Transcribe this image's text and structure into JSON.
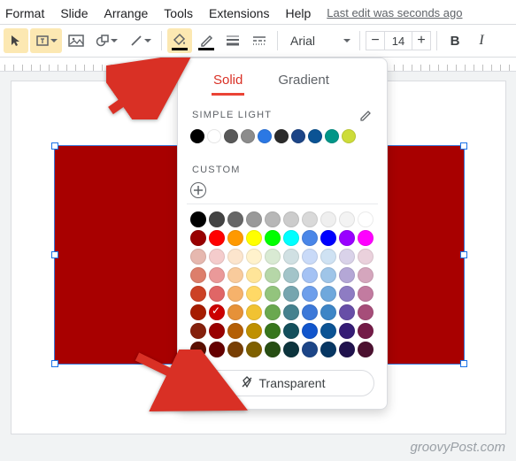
{
  "menubar": {
    "items": [
      "Format",
      "Slide",
      "Arrange",
      "Tools",
      "Extensions",
      "Help"
    ],
    "edit_status": "Last edit was seconds ago"
  },
  "toolbar": {
    "font_family": "Arial",
    "font_size": "14"
  },
  "popover": {
    "tabs": {
      "solid": "Solid",
      "gradient": "Gradient",
      "active": "solid"
    },
    "theme_label": "SIMPLE LIGHT",
    "custom_label": "CUSTOM",
    "transparent_label": "Transparent",
    "theme_colors": [
      "#000000",
      "#ffffff",
      "#595959",
      "#8c8c8c",
      "#2b78e4",
      "#2b2b2b",
      "#1c4587",
      "#0b5394",
      "#009688",
      "#cddc39"
    ],
    "selected_grid_color": "#cc0000",
    "grid_rows": [
      [
        "#000000",
        "#434343",
        "#666666",
        "#999999",
        "#b7b7b7",
        "#cccccc",
        "#d9d9d9",
        "#efefef",
        "#f3f3f3",
        "#ffffff"
      ],
      [
        "#980000",
        "#ff0000",
        "#ff9900",
        "#ffff00",
        "#00ff00",
        "#00ffff",
        "#4a86e8",
        "#0000ff",
        "#9900ff",
        "#ff00ff"
      ],
      [
        "#e6b8af",
        "#f4cccc",
        "#fce5cd",
        "#fff2cc",
        "#d9ead3",
        "#d0e0e3",
        "#c9daf8",
        "#cfe2f3",
        "#d9d2e9",
        "#ead1dc"
      ],
      [
        "#dd7e6b",
        "#ea9999",
        "#f9cb9c",
        "#ffe599",
        "#b6d7a8",
        "#a2c4c9",
        "#a4c2f4",
        "#9fc5e8",
        "#b4a7d6",
        "#d5a6bd"
      ],
      [
        "#cc4125",
        "#e06666",
        "#f6b26b",
        "#ffd966",
        "#93c47d",
        "#76a5af",
        "#6d9eeb",
        "#6fa8dc",
        "#8e7cc3",
        "#c27ba0"
      ],
      [
        "#a61c00",
        "#cc0000",
        "#e69138",
        "#f1c232",
        "#6aa84f",
        "#45818e",
        "#3c78d8",
        "#3d85c6",
        "#674ea7",
        "#a64d79"
      ],
      [
        "#85200c",
        "#990000",
        "#b45f06",
        "#bf9000",
        "#38761d",
        "#134f5c",
        "#1155cc",
        "#0b5394",
        "#351c75",
        "#741b47"
      ],
      [
        "#5b0f00",
        "#660000",
        "#783f04",
        "#7f6000",
        "#274e13",
        "#0c343d",
        "#1c4587",
        "#073763",
        "#20124d",
        "#4c1130"
      ]
    ]
  },
  "slide": {
    "shape_fill": "#a80000"
  },
  "watermark": "groovyPost.com"
}
